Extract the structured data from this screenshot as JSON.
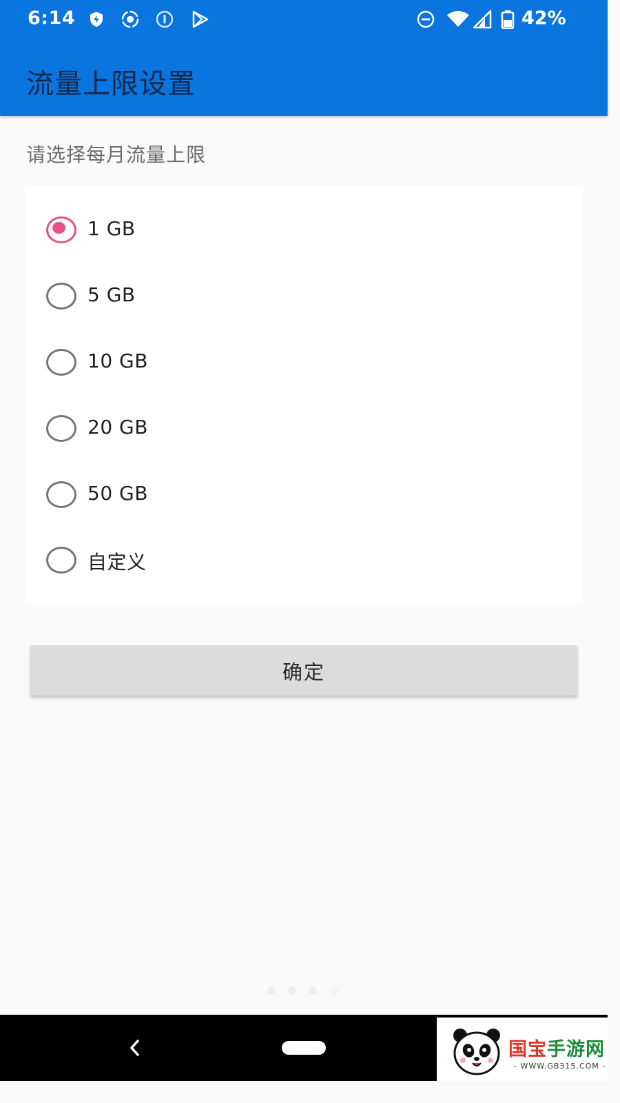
{
  "status_bar": {
    "time": "6:14",
    "battery": "42%",
    "icons": [
      "shield-bolt-icon",
      "screen-record-icon",
      "info-circle-icon",
      "play-store-icon",
      "do-not-disturb-icon",
      "wifi-icon",
      "signal-icon",
      "battery-icon"
    ]
  },
  "app_bar": {
    "title": "流量上限设置"
  },
  "prompt": "请选择每月流量上限",
  "options": [
    {
      "label": "1 GB",
      "selected": true
    },
    {
      "label": "5 GB",
      "selected": false
    },
    {
      "label": "10 GB",
      "selected": false
    },
    {
      "label": "20 GB",
      "selected": false
    },
    {
      "label": "50 GB",
      "selected": false
    },
    {
      "label": "自定义",
      "selected": false
    }
  ],
  "confirm_label": "确定",
  "nav": {
    "back": "back-icon",
    "home": "home-pill"
  },
  "watermark": {
    "name_prefix": "国宝",
    "name_suffix": "手游网",
    "url": "- WWW.GB315.COM -"
  },
  "colors": {
    "primary": "#0a74df",
    "accent": "#e74f85",
    "button": "#dcdcdc"
  }
}
